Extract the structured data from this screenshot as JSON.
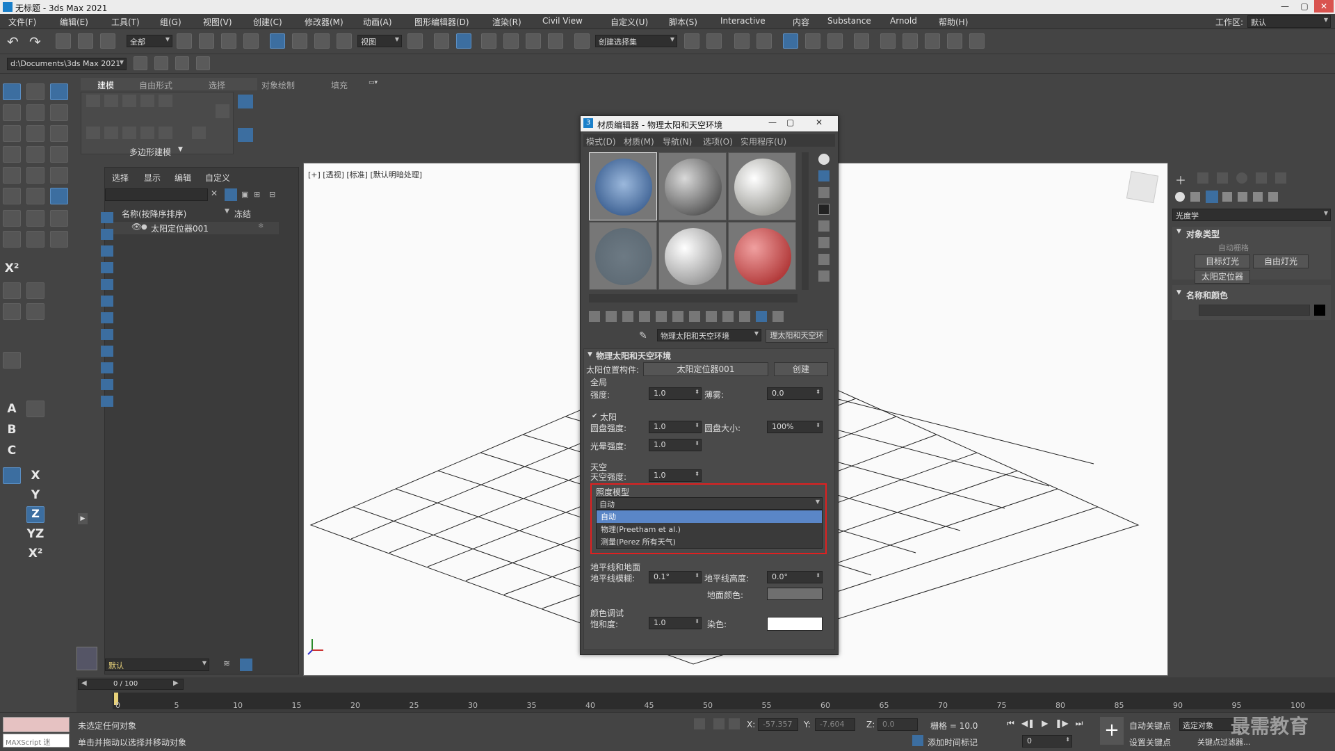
{
  "app": {
    "title": "无标题 - 3ds Max 2021",
    "workspace_label": "工作区:",
    "workspace_value": "默认"
  },
  "menus": [
    "文件(F)",
    "编辑(E)",
    "工具(T)",
    "组(G)",
    "视图(V)",
    "创建(C)",
    "修改器(M)",
    "动画(A)",
    "图形编辑器(D)",
    "渲染(R)",
    "Civil View",
    "自定义(U)",
    "脚本(S)",
    "Interactive",
    "内容",
    "Substance",
    "Arnold",
    "帮助(H)"
  ],
  "toolbar": {
    "selection_filter": "全部",
    "ref_coord": "视图",
    "named_selection": "创建选择集",
    "path": "d:\\Documents\\3ds Max 2021"
  },
  "ribbon": {
    "tabs": [
      "建模",
      "自由形式",
      "选择",
      "对象绘制",
      "填充"
    ],
    "group_label": "多边形建模"
  },
  "explorer": {
    "tabs": [
      "选择",
      "显示",
      "编辑",
      "自定义"
    ],
    "col_name": "名称(按降序排序)",
    "col_frozen": "冻结",
    "rows": [
      "太阳定位器001"
    ],
    "layer_value": "默认"
  },
  "viewport": {
    "label": "[+] [透视] [标准] [默认明暗处理]"
  },
  "right_panel": {
    "category": "光度学",
    "object_type_title": "对象类型",
    "auto_grid": "自动栅格",
    "buttons": [
      "目标灯光",
      "自由灯光",
      "太阳定位器"
    ],
    "name_color_title": "名称和颜色"
  },
  "material_editor": {
    "title": "材质编辑器 - 物理太阳和天空环境",
    "menus": [
      "模式(D)",
      "材质(M)",
      "导航(N)",
      "选项(O)",
      "实用程序(U)"
    ],
    "material_dropdown": "物理太阳和天空环境",
    "material_type": "理太阳和天空环",
    "rollout_title": "物理太阳和天空环境",
    "sun_pos_label": "太阳位置构件:",
    "sun_pos_value": "太阳定位器001",
    "create_label": "创建",
    "global_title": "全局",
    "intensity_label": "强度:",
    "intensity_value": "1.0",
    "haze_label": "薄雾:",
    "haze_value": "0.0",
    "sun_title": "太阳",
    "disc_intensity_label": "圆盘强度:",
    "disc_intensity_value": "1.0",
    "disc_size_label": "圆盘大小:",
    "disc_size_value": "100%",
    "glow_label": "光晕强度:",
    "glow_value": "1.0",
    "sky_title": "天空",
    "sky_intensity_label": "天空强度:",
    "sky_intensity_value": "1.0",
    "illum_title": "照度模型",
    "illum_value": "自动",
    "illum_options": [
      "自动",
      "物理(Preetham et al.)",
      "测量(Perez 所有天气)"
    ],
    "horizon_title": "地平线和地面",
    "horizon_blur_label": "地平线模糊:",
    "horizon_blur_value": "0.1°",
    "horizon_height_label": "地平线高度:",
    "horizon_height_value": "0.0°",
    "ground_color_label": "地面颜色:",
    "color_title": "颜色调试",
    "saturation_label": "饱和度:",
    "saturation_value": "1.0",
    "tint_label": "染色:"
  },
  "timeline": {
    "frame": "0 / 100",
    "ticks": [
      "0",
      "5",
      "10",
      "15",
      "20",
      "25",
      "30",
      "35",
      "40",
      "45",
      "50",
      "55",
      "60",
      "65",
      "70",
      "75",
      "80",
      "85",
      "90",
      "95",
      "100"
    ]
  },
  "status": {
    "line1": "未选定任何对象",
    "line2": "单击并拖动以选择并移动对象",
    "maxscript": "MAXScript 迷",
    "x_label": "X:",
    "x_value": "-57.357",
    "y_label": "Y:",
    "y_value": "-7.604",
    "z_label": "Z:",
    "z_value": "0.0",
    "grid": "栅格 = 10.0",
    "add_time_tag": "添加时间标记",
    "auto_key": "自动关键点",
    "set_key": "设置关键点",
    "selected_obj": "选定对象",
    "key_filter": "关键点过滤器...",
    "current_frame": "0",
    "watermark": "最需教育"
  }
}
